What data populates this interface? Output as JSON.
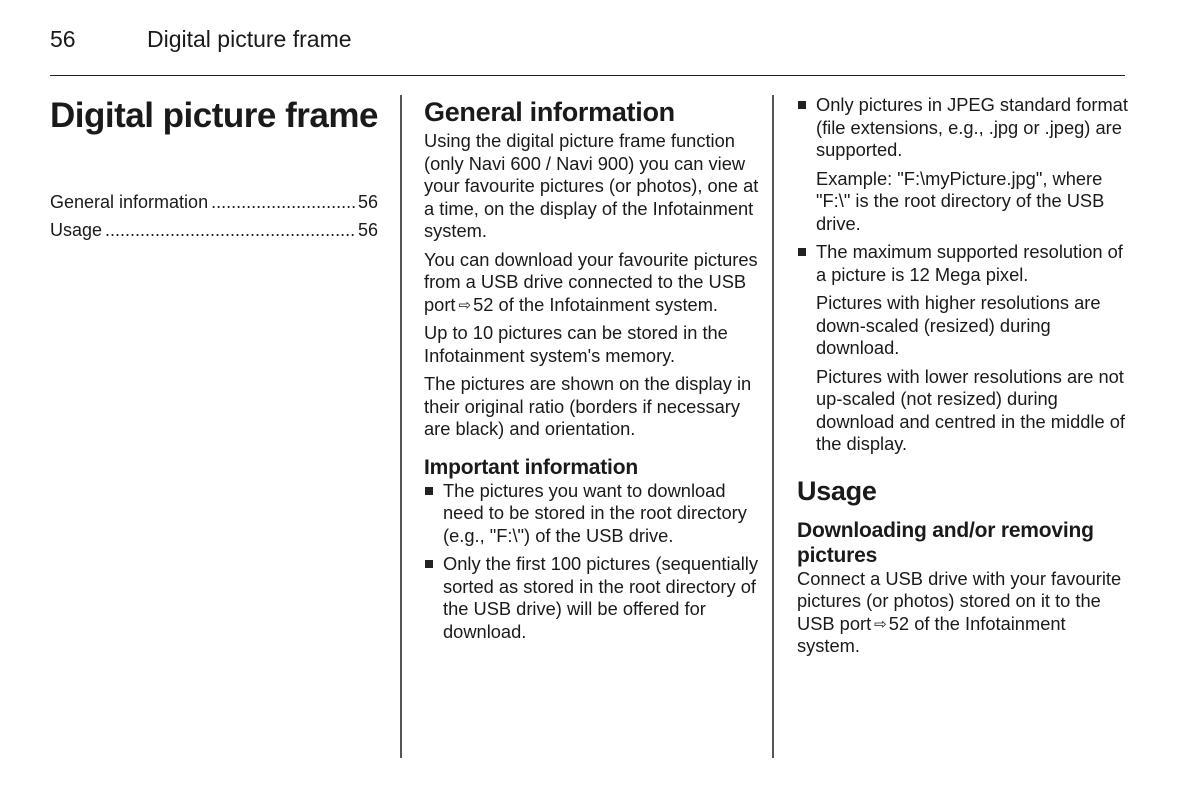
{
  "header": {
    "page_number": "56",
    "running_title": "Digital picture frame"
  },
  "chapter": {
    "title": "Digital picture frame",
    "toc": [
      {
        "label": "General information",
        "page": "56"
      },
      {
        "label": "Usage",
        "page": "56"
      }
    ]
  },
  "general_information": {
    "title": "General information",
    "paragraphs": {
      "p1": "Using the digital picture frame function (only Navi 600 / Navi 900) you can view your favourite pictures (or photos), one at a time, on the display of the Infotainment system.",
      "p2_before": "You can download your favourite pictures from a USB drive connected to the USB port",
      "p2_ref_icon": "arrow-reference-icon",
      "p2_ref_page": "52",
      "p2_after": "of the Infotainment system.",
      "p3": "Up to 10 pictures can be stored in the Infotainment system's memory.",
      "p4": "The pictures are shown on the display in their original ratio (borders if necessary are black) and orientation."
    },
    "important": {
      "title": "Important information",
      "bullets": [
        {
          "text": "The pictures you want to download need to be stored in the root directory (e.g., \"F:\\\") of the USB drive."
        },
        {
          "text": "Only the first 100 pictures (sequentially sorted as stored in the root directory of the USB drive) will be offered for download."
        },
        {
          "text": "Only pictures in JPEG standard format (file extensions, e.g., .jpg or .jpeg) are supported.",
          "extra": [
            "Example: \"F:\\myPicture.jpg\", where \"F:\\\" is the root directory of the USB drive."
          ]
        },
        {
          "text": "The maximum supported resolution of a picture is 12 Mega pixel.",
          "extra": [
            "Pictures with higher resolutions are down-scaled (resized) during download.",
            "Pictures with lower resolutions are not up-scaled (not resized) during download and centred in the middle of the display."
          ]
        }
      ]
    }
  },
  "usage": {
    "title": "Usage",
    "subsection_title": "Downloading and/or removing pictures",
    "p_before": "Connect a USB drive with your favourite pictures (or photos) stored on it to the USB port",
    "p_ref_page": "52",
    "p_after": "of the Infotainment system."
  },
  "icons": {
    "reference_arrow": "⇨",
    "bullet": "square-bullet-icon"
  }
}
